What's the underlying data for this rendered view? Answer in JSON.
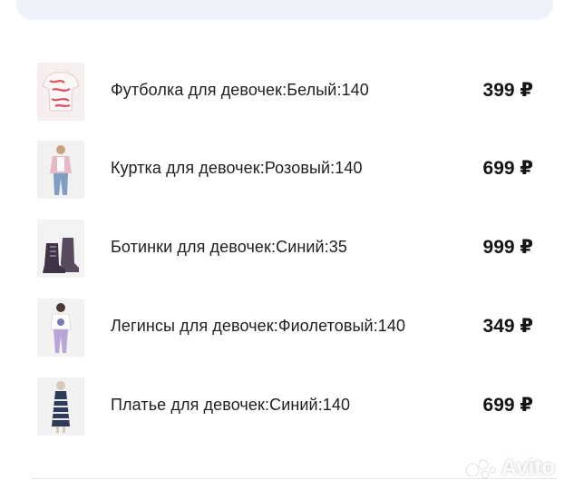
{
  "items": [
    {
      "title": "Футболка для девочек:Белый:140",
      "price": "399 ₽",
      "thumb_icon": "tshirt-icon"
    },
    {
      "title": "Куртка для девочек:Розовый:140",
      "price": "699 ₽",
      "thumb_icon": "jacket-icon"
    },
    {
      "title": "Ботинки для девочек:Синий:35",
      "price": "999 ₽",
      "thumb_icon": "boots-icon"
    },
    {
      "title": "Легинсы для девочек:Фиолетовый:140",
      "price": "349 ₽",
      "thumb_icon": "leggings-icon"
    },
    {
      "title": "Платье для девочек:Синий:140",
      "price": "699 ₽",
      "thumb_icon": "dress-icon"
    }
  ],
  "watermark": {
    "text": "Avito"
  },
  "colors": {
    "top_card": "#eef3fb",
    "text": "#1f1f1f",
    "divider": "#e6e6e6"
  }
}
